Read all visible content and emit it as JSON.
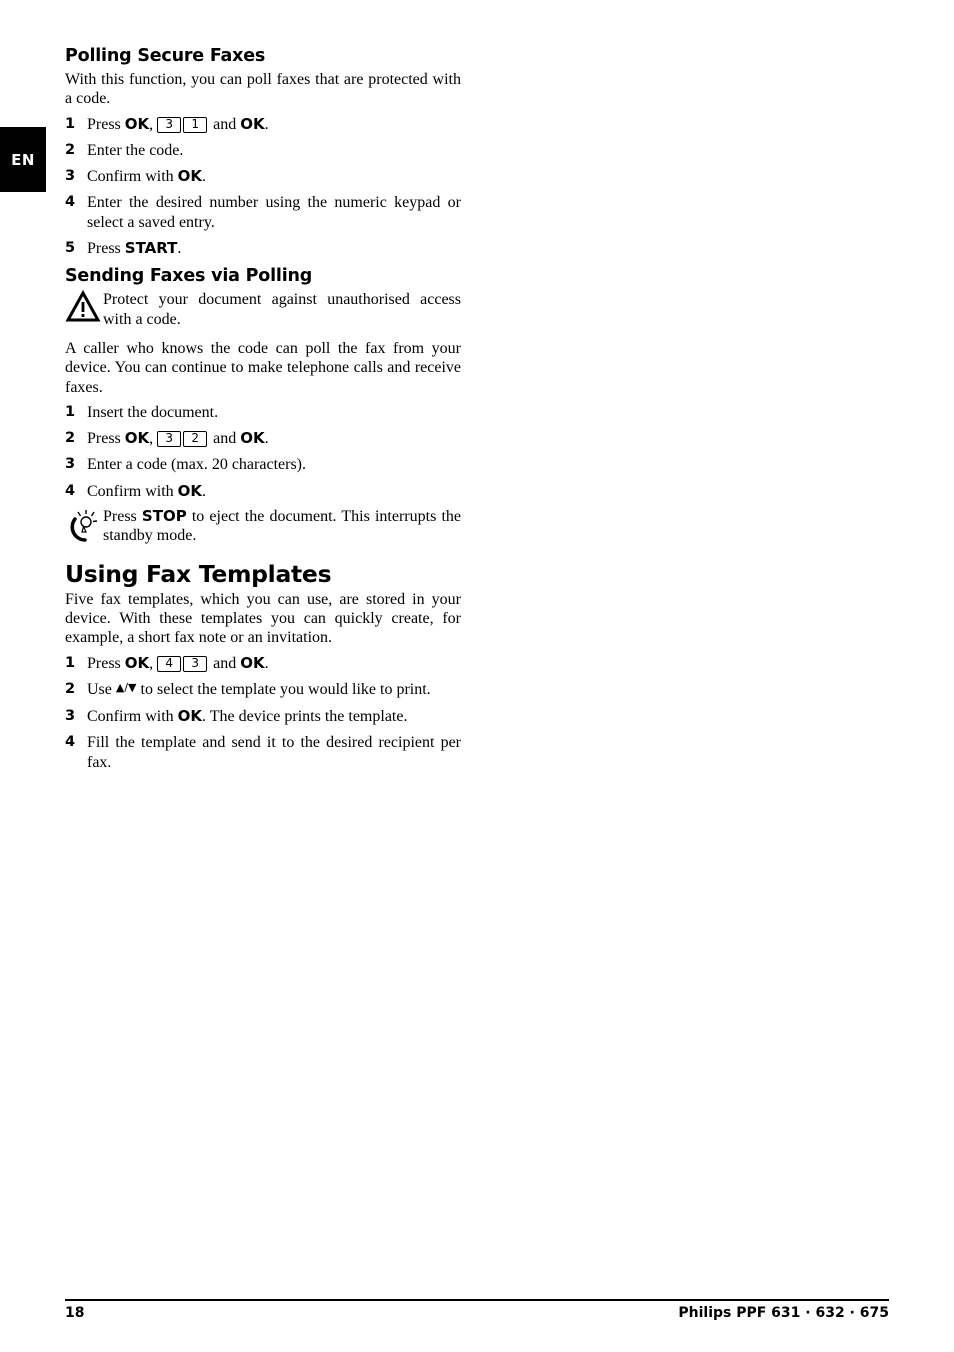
{
  "language_tab": "EN",
  "sections": {
    "polling_secure": {
      "heading": "Polling Secure Faxes",
      "intro": "With this function, you can poll faxes that are protected with a code.",
      "steps": [
        {
          "num": "1",
          "pre": "Press ",
          "kw1": "OK",
          "mid": ", ",
          "keys": [
            "3",
            "1"
          ],
          "post1": " and ",
          "kw2": "OK",
          "end": "."
        },
        {
          "num": "2",
          "text": "Enter the code."
        },
        {
          "num": "3",
          "pre": "Confirm with ",
          "kw": "OK",
          "end": "."
        },
        {
          "num": "4",
          "text": "Enter the desired number using the numeric keypad or select a saved entry."
        },
        {
          "num": "5",
          "pre": "Press ",
          "kw": "START",
          "end": "."
        }
      ]
    },
    "sending_polling": {
      "heading": "Sending Faxes via Polling",
      "warning": {
        "icon": "warning-triangle-icon",
        "text": "Protect your document against unauthorised access with a code."
      },
      "body": "A caller who knows the code can poll the fax from your device. You can continue to make telephone calls and receive faxes.",
      "steps": [
        {
          "num": "1",
          "text": "Insert the document."
        },
        {
          "num": "2",
          "pre": "Press ",
          "kw1": "OK",
          "mid": ", ",
          "keys": [
            "3",
            "2"
          ],
          "post1": " and ",
          "kw2": "OK",
          "end": "."
        },
        {
          "num": "3",
          "text": "Enter a code (max. 20 characters)."
        },
        {
          "num": "4",
          "pre": "Confirm with ",
          "kw": "OK",
          "end": "."
        }
      ],
      "tip": {
        "icon": "lightbulb-tip-icon",
        "pre": "Press ",
        "kw": "STOP",
        "post": " to eject the document. This interrupts the standby mode."
      }
    },
    "fax_templates": {
      "heading": "Using Fax Templates",
      "intro": "Five fax templates, which you can use, are stored in your device. With these templates you can quickly create, for example, a short fax note or an invitation.",
      "steps": [
        {
          "num": "1",
          "pre": "Press ",
          "kw1": "OK",
          "mid": ", ",
          "keys": [
            "4",
            "3"
          ],
          "post1": " and ",
          "kw2": "OK",
          "end": "."
        },
        {
          "num": "2",
          "pre": "Use ",
          "arrows": "▲/▼",
          "post": " to select the template you would like to print."
        },
        {
          "num": "3",
          "pre": "Confirm with ",
          "kw": "OK",
          "post": ". The device prints the template."
        },
        {
          "num": "4",
          "text": "Fill the template and send it to the desired recipient per fax."
        }
      ]
    }
  },
  "footer": {
    "page_number": "18",
    "product": "Philips PPF 631 · 632 · 675"
  }
}
